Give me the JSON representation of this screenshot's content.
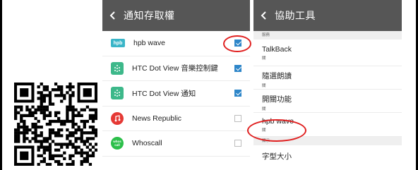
{
  "left_panel": {
    "title": "通知存取權",
    "apps": [
      {
        "label": "hpb wave",
        "checked": true,
        "icon": "hpb-logo-icon",
        "icon_text": "hpb",
        "color": "#3ab5c8"
      },
      {
        "label": "HTC Dot View 音樂控制鍵",
        "checked": true,
        "icon": "htc-dot-view-icon",
        "color": "#3db88a"
      },
      {
        "label": "HTC Dot View 通知",
        "checked": true,
        "icon": "htc-dot-view-icon",
        "color": "#3db88a"
      },
      {
        "label": "News Republic",
        "checked": false,
        "icon": "news-republic-icon",
        "color": "#e53935"
      },
      {
        "label": "Whoscall",
        "checked": false,
        "icon": "whoscall-icon",
        "icon_text": "whos call",
        "color": "#2cbf4a"
      }
    ]
  },
  "right_panel": {
    "title": "協助工具",
    "section_services": "服務",
    "items": [
      {
        "title": "TalkBack",
        "sub": "關"
      },
      {
        "title": "隨選朗讀",
        "sub": "關"
      },
      {
        "title": "開關功能",
        "sub": "關"
      },
      {
        "title": "hpb wave",
        "sub": "關"
      }
    ],
    "section_display": "顯示",
    "display_items": [
      {
        "title": "字型大小"
      }
    ]
  },
  "colors": {
    "toolbar": "#565656",
    "accent": "#2e86c9",
    "highlight": "#e02020"
  }
}
